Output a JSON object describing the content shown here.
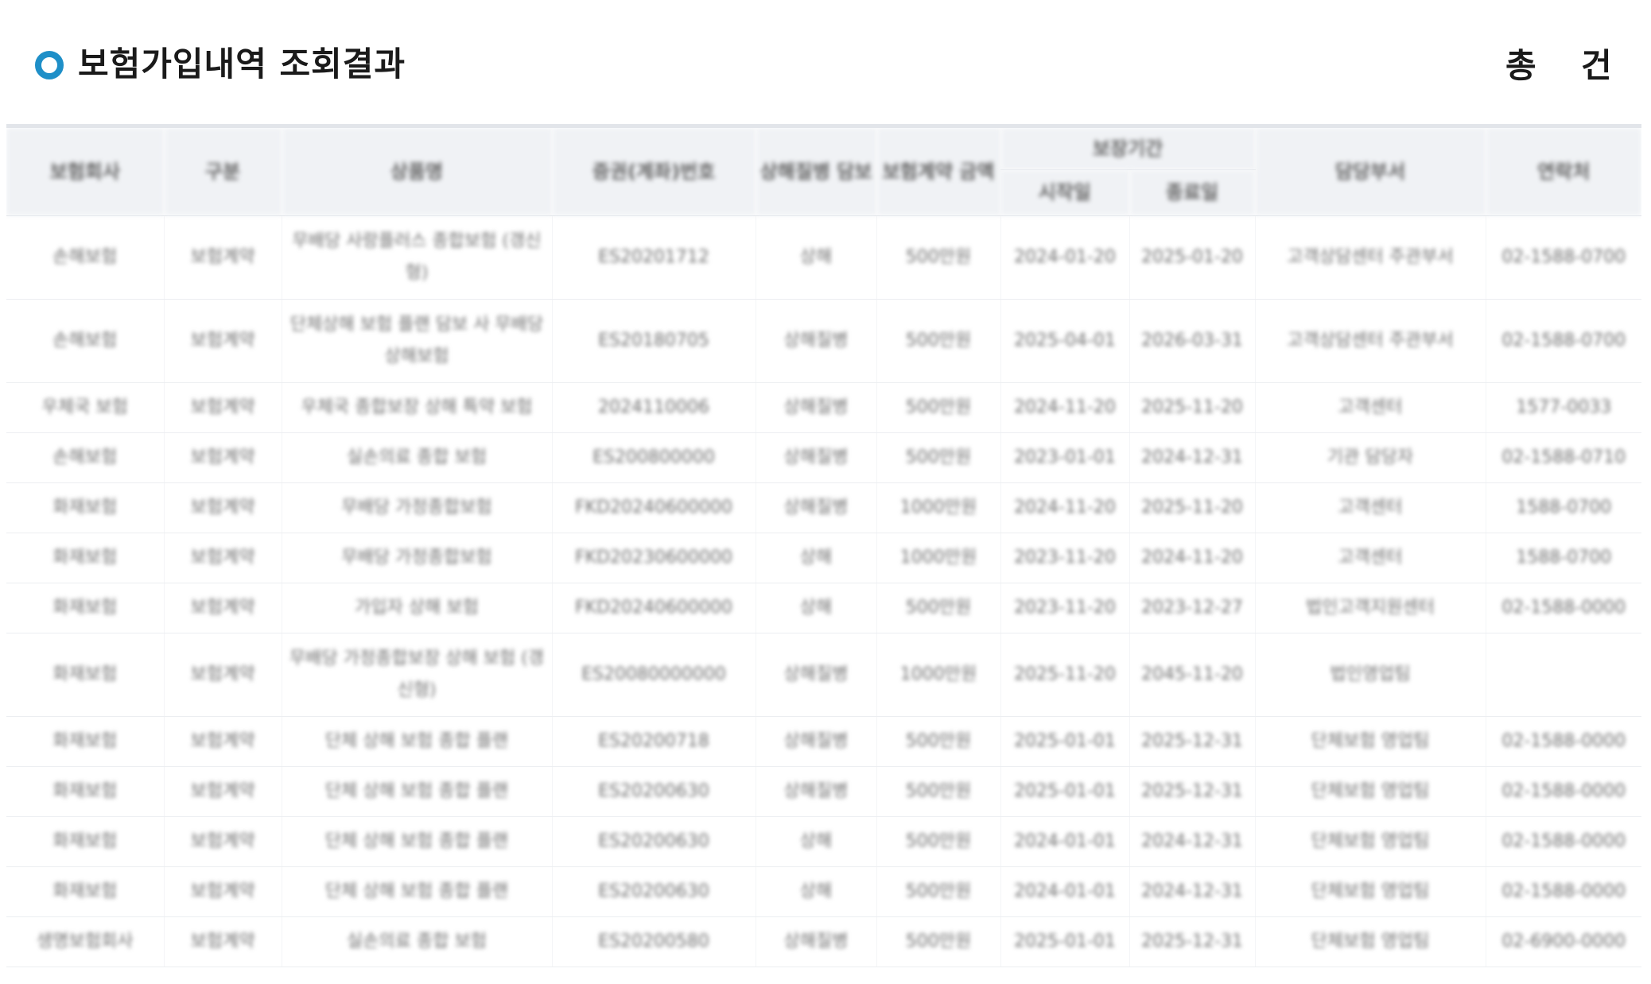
{
  "header": {
    "title": "보험가입내역 조회결과",
    "total_label": "총",
    "count_unit": "건"
  },
  "table": {
    "columns": [
      "보험회사",
      "구분",
      "상품명",
      "증권(계좌)번호",
      "상해질병 담보",
      "보험계약 금액",
      "보장기간",
      "담당부서",
      "연락처"
    ],
    "sub_columns": [
      "시작일",
      "종료일"
    ],
    "rows": [
      [
        "손해보험",
        "보험계약",
        "무배당 사랑플러스 종합보험 (갱신형)",
        "ES20201712",
        "상해",
        "500만원",
        "2024-01-20",
        "2025-01-20",
        "고객상담센터 주관부서",
        "02-1588-0700"
      ],
      [
        "손해보험",
        "보험계약",
        "단체상해 보험 플랜 담보 사 무배당 상해보험",
        "ES20180705",
        "상해질병",
        "500만원",
        "2025-04-01",
        "2026-03-31",
        "고객상담센터 주관부서",
        "02-1588-0700"
      ],
      [
        "우체국 보험",
        "보험계약",
        "우체국 종합보장 상해 특약 보험",
        "2024110006",
        "상해질병",
        "500만원",
        "2024-11-20",
        "2025-11-20",
        "고객센터",
        "1577-0033"
      ],
      [
        "손해보험",
        "보험계약",
        "실손의료 종합 보험",
        "ES200800000",
        "상해질병",
        "500만원",
        "2023-01-01",
        "2024-12-31",
        "기관 담당자",
        "02-1588-0710"
      ],
      [
        "화재보험",
        "보험계약",
        "무배당 가정종합보험",
        "FKD20240600000",
        "상해질병",
        "1000만원",
        "2024-11-20",
        "2025-11-20",
        "고객센터",
        "1588-0700"
      ],
      [
        "화재보험",
        "보험계약",
        "무배당 가정종합보험",
        "FKD20230600000",
        "상해",
        "1000만원",
        "2023-11-20",
        "2024-11-20",
        "고객센터",
        "1588-0700"
      ],
      [
        "화재보험",
        "보험계약",
        "가입자 상해 보험",
        "FKD20240600000",
        "상해",
        "500만원",
        "2023-11-20",
        "2023-12-27",
        "법인고객지원센터",
        "02-1588-0000"
      ],
      [
        "화재보험",
        "보험계약",
        "무배당 가정종합보장 상해 보험 (갱신형)",
        "ES20080000000",
        "상해질병",
        "1000만원",
        "2025-11-20",
        "2045-11-20",
        "법인영업팀",
        ""
      ],
      [
        "화재보험",
        "보험계약",
        "단체 상해 보험 종합 플랜",
        "ES20200718",
        "상해질병",
        "500만원",
        "2025-01-01",
        "2025-12-31",
        "단체보험 영업팀",
        "02-1588-0000"
      ],
      [
        "화재보험",
        "보험계약",
        "단체 상해 보험 종합 플랜",
        "ES20200630",
        "상해질병",
        "500만원",
        "2025-01-01",
        "2025-12-31",
        "단체보험 영업팀",
        "02-1588-0000"
      ],
      [
        "화재보험",
        "보험계약",
        "단체 상해 보험 종합 플랜",
        "ES20200630",
        "상해",
        "500만원",
        "2024-01-01",
        "2024-12-31",
        "단체보험 영업팀",
        "02-1588-0000"
      ],
      [
        "화재보험",
        "보험계약",
        "단체 상해 보험 종합 플랜",
        "ES20200630",
        "상해",
        "500만원",
        "2024-01-01",
        "2024-12-31",
        "단체보험 영업팀",
        "02-1588-0000"
      ],
      [
        "생명보험회사",
        "보험계약",
        "실손의료 종합 보험",
        "ES20200580",
        "상해질병",
        "500만원",
        "2025-01-01",
        "2025-12-31",
        "단체보험 영업팀",
        "02-6900-0000"
      ]
    ]
  },
  "colors": {
    "accent": "#1e8fc8",
    "header_bg": "#f0f2f5",
    "text": "#1a1a1a"
  },
  "icons": {
    "bullet": "circle-bullet-icon"
  }
}
